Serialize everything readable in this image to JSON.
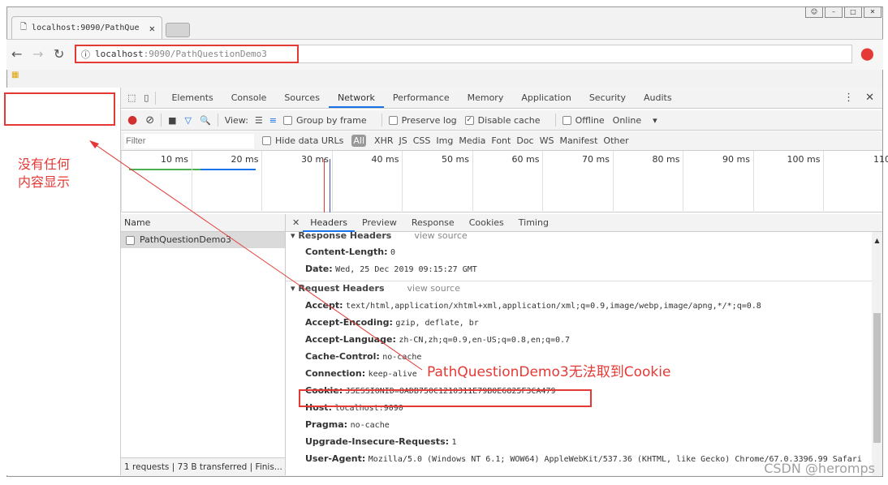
{
  "browser": {
    "tab_title": "localhost:9090/PathQue",
    "url_host": "localhost",
    "url_rest": ":9090/PathQuestionDemo3"
  },
  "devtools": {
    "tabs": [
      "Elements",
      "Console",
      "Sources",
      "Network",
      "Performance",
      "Memory",
      "Application",
      "Security",
      "Audits"
    ],
    "active_tab": "Network",
    "toolbar": {
      "view_label": "View:",
      "group_by_frame": "Group by frame",
      "preserve_log": "Preserve log",
      "disable_cache": "Disable cache",
      "disable_cache_checked": true,
      "offline": "Offline",
      "throttle": "Online"
    },
    "filter": {
      "placeholder": "Filter",
      "hide_data_urls": "Hide data URLs",
      "types": [
        "All",
        "XHR",
        "JS",
        "CSS",
        "Img",
        "Media",
        "Font",
        "Doc",
        "WS",
        "Manifest",
        "Other"
      ]
    },
    "timeline_ticks": [
      "10 ms",
      "20 ms",
      "30 ms",
      "40 ms",
      "50 ms",
      "60 ms",
      "70 ms",
      "80 ms",
      "90 ms",
      "100 ms",
      "110"
    ],
    "name_header": "Name",
    "requests": [
      "PathQuestionDemo3"
    ],
    "status": "1 requests | 73 B transferred | Finis...",
    "detail_tabs": [
      "Headers",
      "Preview",
      "Response",
      "Cookies",
      "Timing"
    ],
    "response_headers_title": "Response Headers",
    "view_source": "view source",
    "response_headers": [
      {
        "k": "Content-Length:",
        "v": "0"
      },
      {
        "k": "Date:",
        "v": "Wed, 25 Dec 2019 09:15:27 GMT"
      }
    ],
    "request_headers_title": "Request Headers",
    "request_headers": [
      {
        "k": "Accept:",
        "v": "text/html,application/xhtml+xml,application/xml;q=0.9,image/webp,image/apng,*/*;q=0.8"
      },
      {
        "k": "Accept-Encoding:",
        "v": "gzip, deflate, br"
      },
      {
        "k": "Accept-Language:",
        "v": "zh-CN,zh;q=0.9,en-US;q=0.8,en;q=0.7"
      },
      {
        "k": "Cache-Control:",
        "v": "no-cache"
      },
      {
        "k": "Connection:",
        "v": "keep-alive"
      },
      {
        "k": "Cookie:",
        "v": "JSESSIONID=8ADB750C1210311E79B0E6825F3CA479"
      },
      {
        "k": "Host:",
        "v": "localhost:9090"
      },
      {
        "k": "Pragma:",
        "v": "no-cache"
      },
      {
        "k": "Upgrade-Insecure-Requests:",
        "v": "1"
      },
      {
        "k": "User-Agent:",
        "v": "Mozilla/5.0 (Windows NT 6.1; WOW64) AppleWebKit/537.36 (KHTML, like Gecko) Chrome/67.0.3396.99 Safari"
      }
    ]
  },
  "annotations": {
    "left_line1": "没有任何",
    "left_line2": "内容显示",
    "cookie_note": "PathQuestionDemo3无法取到Cookie",
    "watermark": "CSDN @heromps"
  },
  "colors": {
    "annotation": "#e53935",
    "accent": "#1a73e8"
  }
}
